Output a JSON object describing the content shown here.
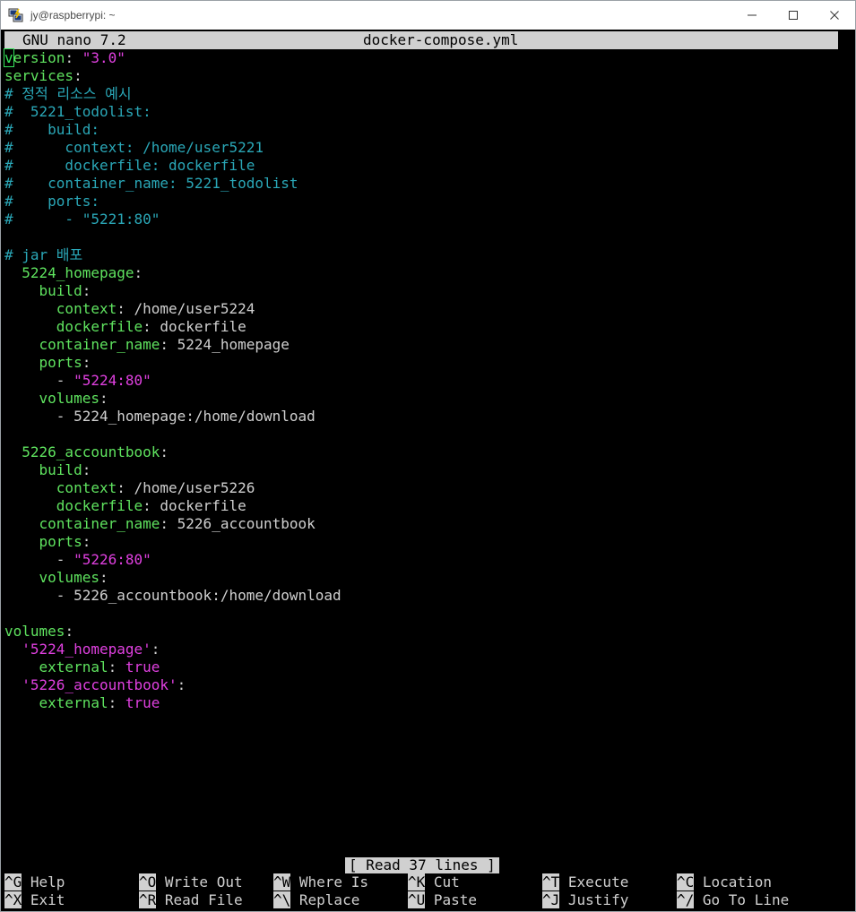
{
  "window": {
    "title": "jy@raspberrypi: ~",
    "icon": "putty-icon"
  },
  "nano": {
    "version_label": "GNU nano 7.2",
    "filename": "docker-compose.yml",
    "status": "[ Read 37 lines ]"
  },
  "lines": [
    {
      "segs": [
        {
          "t": "v",
          "c": "cursor"
        },
        {
          "t": "ersion",
          "c": "k"
        },
        {
          "t": ": ",
          "c": "p"
        },
        {
          "t": "\"3.0\"",
          "c": "s"
        }
      ]
    },
    {
      "segs": [
        {
          "t": "services",
          "c": "k"
        },
        {
          "t": ":",
          "c": "p"
        }
      ]
    },
    {
      "segs": [
        {
          "t": "# 정적 리소스 예시",
          "c": "c"
        }
      ]
    },
    {
      "segs": [
        {
          "t": "#  5221_todolist:",
          "c": "c"
        }
      ]
    },
    {
      "segs": [
        {
          "t": "#    build:",
          "c": "c"
        }
      ]
    },
    {
      "segs": [
        {
          "t": "#      context: /home/user5221",
          "c": "c"
        }
      ]
    },
    {
      "segs": [
        {
          "t": "#      dockerfile: dockerfile",
          "c": "c"
        }
      ]
    },
    {
      "segs": [
        {
          "t": "#    container_name: 5221_todolist",
          "c": "c"
        }
      ]
    },
    {
      "segs": [
        {
          "t": "#    ports:",
          "c": "c"
        }
      ]
    },
    {
      "segs": [
        {
          "t": "#      - \"5221:80\"",
          "c": "c"
        }
      ]
    },
    {
      "segs": []
    },
    {
      "segs": [
        {
          "t": "# jar 배포",
          "c": "c"
        }
      ]
    },
    {
      "segs": [
        {
          "t": "  5224_homepage",
          "c": "k"
        },
        {
          "t": ":",
          "c": "p"
        }
      ]
    },
    {
      "segs": [
        {
          "t": "    build",
          "c": "k"
        },
        {
          "t": ":",
          "c": "p"
        }
      ]
    },
    {
      "segs": [
        {
          "t": "      context",
          "c": "k"
        },
        {
          "t": ": /home/user5224",
          "c": "p"
        }
      ]
    },
    {
      "segs": [
        {
          "t": "      dockerfile",
          "c": "k"
        },
        {
          "t": ": dockerfile",
          "c": "p"
        }
      ]
    },
    {
      "segs": [
        {
          "t": "    container_name",
          "c": "k"
        },
        {
          "t": ": 5224_homepage",
          "c": "p"
        }
      ]
    },
    {
      "segs": [
        {
          "t": "    ports",
          "c": "k"
        },
        {
          "t": ":",
          "c": "p"
        }
      ]
    },
    {
      "segs": [
        {
          "t": "      - ",
          "c": "p"
        },
        {
          "t": "\"5224:80\"",
          "c": "s"
        }
      ]
    },
    {
      "segs": [
        {
          "t": "    volumes",
          "c": "k"
        },
        {
          "t": ":",
          "c": "p"
        }
      ]
    },
    {
      "segs": [
        {
          "t": "      - 5224_homepage:/home/download",
          "c": "p"
        }
      ]
    },
    {
      "segs": []
    },
    {
      "segs": [
        {
          "t": "  5226_accountbook",
          "c": "k"
        },
        {
          "t": ":",
          "c": "p"
        }
      ]
    },
    {
      "segs": [
        {
          "t": "    build",
          "c": "k"
        },
        {
          "t": ":",
          "c": "p"
        }
      ]
    },
    {
      "segs": [
        {
          "t": "      context",
          "c": "k"
        },
        {
          "t": ": /home/user5226",
          "c": "p"
        }
      ]
    },
    {
      "segs": [
        {
          "t": "      dockerfile",
          "c": "k"
        },
        {
          "t": ": dockerfile",
          "c": "p"
        }
      ]
    },
    {
      "segs": [
        {
          "t": "    container_name",
          "c": "k"
        },
        {
          "t": ": 5226_accountbook",
          "c": "p"
        }
      ]
    },
    {
      "segs": [
        {
          "t": "    ports",
          "c": "k"
        },
        {
          "t": ":",
          "c": "p"
        }
      ]
    },
    {
      "segs": [
        {
          "t": "      - ",
          "c": "p"
        },
        {
          "t": "\"5226:80\"",
          "c": "s"
        }
      ]
    },
    {
      "segs": [
        {
          "t": "    volumes",
          "c": "k"
        },
        {
          "t": ":",
          "c": "p"
        }
      ]
    },
    {
      "segs": [
        {
          "t": "      - 5226_accountbook:/home/download",
          "c": "p"
        }
      ]
    },
    {
      "segs": []
    },
    {
      "segs": [
        {
          "t": "volumes",
          "c": "k"
        },
        {
          "t": ":",
          "c": "p"
        }
      ]
    },
    {
      "segs": [
        {
          "t": "  '5224_homepage'",
          "c": "s"
        },
        {
          "t": ":",
          "c": "p"
        }
      ]
    },
    {
      "segs": [
        {
          "t": "    external",
          "c": "k"
        },
        {
          "t": ": ",
          "c": "p"
        },
        {
          "t": "true",
          "c": "s"
        }
      ]
    },
    {
      "segs": [
        {
          "t": "  '5226_accountbook'",
          "c": "s"
        },
        {
          "t": ":",
          "c": "p"
        }
      ]
    },
    {
      "segs": [
        {
          "t": "    external",
          "c": "k"
        },
        {
          "t": ": ",
          "c": "p"
        },
        {
          "t": "true",
          "c": "s"
        }
      ]
    }
  ],
  "shortcuts": [
    [
      {
        "key": "^G",
        "label": "Help"
      },
      {
        "key": "^O",
        "label": "Write Out"
      },
      {
        "key": "^W",
        "label": "Where Is"
      },
      {
        "key": "^K",
        "label": "Cut"
      },
      {
        "key": "^T",
        "label": "Execute"
      },
      {
        "key": "^C",
        "label": "Location"
      }
    ],
    [
      {
        "key": "^X",
        "label": "Exit"
      },
      {
        "key": "^R",
        "label": "Read File"
      },
      {
        "key": "^\\",
        "label": "Replace"
      },
      {
        "key": "^U",
        "label": "Paste"
      },
      {
        "key": "^J",
        "label": "Justify"
      },
      {
        "key": "^/",
        "label": "Go To Line"
      }
    ]
  ]
}
